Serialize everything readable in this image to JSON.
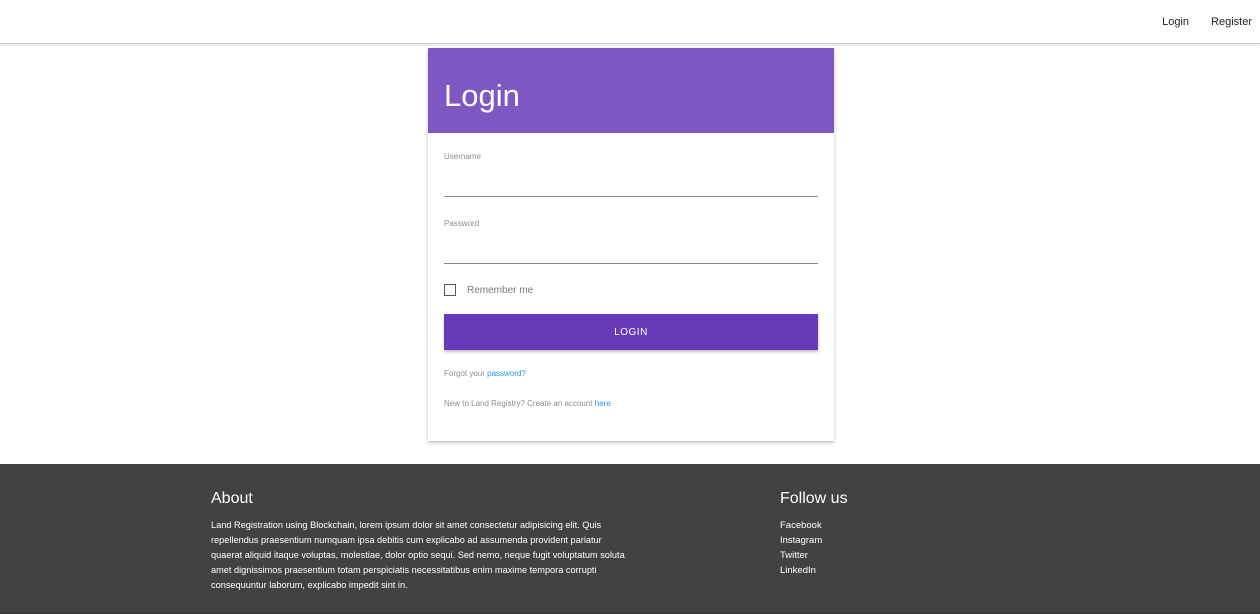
{
  "nav": {
    "login": "Login",
    "register": "Register"
  },
  "card": {
    "title": "Login",
    "username_label": "Username",
    "username_value": "",
    "password_label": "Password",
    "password_value": "",
    "remember_label": "Remember me",
    "remember_checked": false,
    "login_button": "LOGIN",
    "forgot_prefix": "Forgot your ",
    "forgot_link": "password?",
    "new_prefix": "New to Land Registry? Create an account ",
    "new_link": "here"
  },
  "footer": {
    "about_title": "About",
    "about_text": "Land Registration using Blockchain, lorem ipsum dolor sit amet consectetur adipisicing elit. Quis repellendus praesentium numquam ipsa debitis cum explicabo ad assumenda provident pariatur quaerat aliquid itaque voluptas, molestiae, dolor optio sequi. Sed nemo, neque fugit voluptatum soluta amet dignissimos praesentium totam perspiciatis necessitatibus enim maxime tempora corrupti consequuntur laborum, explicabo impedit sint in.",
    "follow_title": "Follow us",
    "links": [
      "Facebook",
      "Instagram",
      "Twitter",
      "LinkedIn"
    ]
  },
  "colors": {
    "header": "#7e57c2",
    "button": "#673ab7",
    "link": "#2196f3",
    "footer": "#424242"
  }
}
